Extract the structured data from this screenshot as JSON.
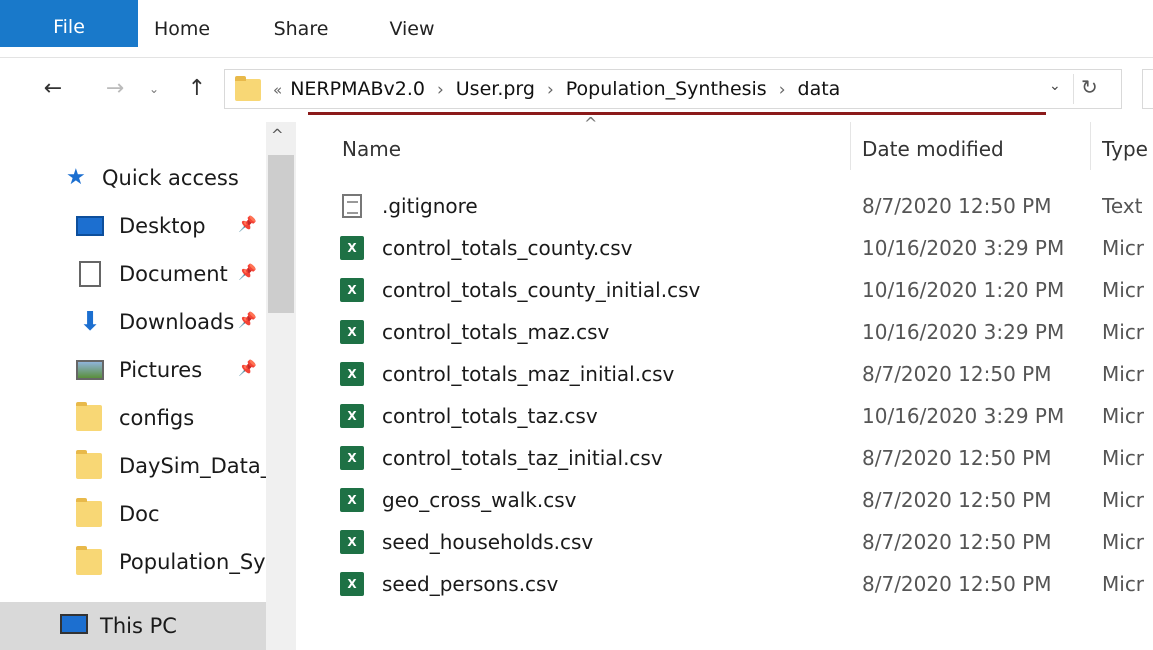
{
  "ribbon": {
    "tabs": [
      {
        "label": "File"
      },
      {
        "label": "Home"
      },
      {
        "label": "Share"
      },
      {
        "label": "View"
      }
    ]
  },
  "address": {
    "lead": "«",
    "crumbs": [
      "NERPMABv2.0",
      "User.prg",
      "Population_Synthesis",
      "data"
    ],
    "separator": "›",
    "dropdown_icon": "chevron-down-icon",
    "refresh_icon": "refresh-icon"
  },
  "nav": {
    "quick_access": "Quick access",
    "items": [
      {
        "label": "Desktop",
        "icon": "desktop-icon",
        "pinned": true
      },
      {
        "label": "Document",
        "icon": "documents-icon",
        "pinned": true
      },
      {
        "label": "Downloads",
        "icon": "downloads-icon",
        "pinned": true
      },
      {
        "label": "Pictures",
        "icon": "pictures-icon",
        "pinned": true
      },
      {
        "label": "configs",
        "icon": "folder-icon",
        "pinned": false
      },
      {
        "label": "DaySim_Data_",
        "icon": "folder-icon",
        "pinned": false
      },
      {
        "label": "Doc",
        "icon": "folder-icon",
        "pinned": false
      },
      {
        "label": "Population_Sy",
        "icon": "folder-icon",
        "pinned": false
      }
    ],
    "this_pc": "This PC"
  },
  "list": {
    "columns": {
      "name": "Name",
      "date": "Date modified",
      "type": "Type"
    },
    "files": [
      {
        "name": ".gitignore",
        "date": "8/7/2020 12:50 PM",
        "type": "Text",
        "icon": "text-file-icon"
      },
      {
        "name": "control_totals_county.csv",
        "date": "10/16/2020 3:29 PM",
        "type": "Micr",
        "icon": "excel-csv-icon"
      },
      {
        "name": "control_totals_county_initial.csv",
        "date": "10/16/2020 1:20 PM",
        "type": "Micr",
        "icon": "excel-csv-icon"
      },
      {
        "name": "control_totals_maz.csv",
        "date": "10/16/2020 3:29 PM",
        "type": "Micr",
        "icon": "excel-csv-icon"
      },
      {
        "name": "control_totals_maz_initial.csv",
        "date": "8/7/2020 12:50 PM",
        "type": "Micr",
        "icon": "excel-csv-icon"
      },
      {
        "name": "control_totals_taz.csv",
        "date": "10/16/2020 3:29 PM",
        "type": "Micr",
        "icon": "excel-csv-icon"
      },
      {
        "name": "control_totals_taz_initial.csv",
        "date": "8/7/2020 12:50 PM",
        "type": "Micr",
        "icon": "excel-csv-icon"
      },
      {
        "name": "geo_cross_walk.csv",
        "date": "8/7/2020 12:50 PM",
        "type": "Micr",
        "icon": "excel-csv-icon"
      },
      {
        "name": "seed_households.csv",
        "date": "8/7/2020 12:50 PM",
        "type": "Micr",
        "icon": "excel-csv-icon"
      },
      {
        "name": "seed_persons.csv",
        "date": "8/7/2020 12:50 PM",
        "type": "Micr",
        "icon": "excel-csv-icon"
      }
    ]
  },
  "colors": {
    "file_tab": "#1979ca",
    "underline": "#8b1a1a",
    "excel": "#1e7145"
  }
}
